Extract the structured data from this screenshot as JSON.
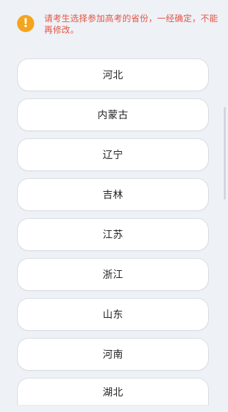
{
  "notice": {
    "icon": "exclamation-icon",
    "text": "请考生选择参加高考的省份，一经确定，不能再修改。"
  },
  "provinces": [
    {
      "label": "河北"
    },
    {
      "label": "内蒙古"
    },
    {
      "label": "辽宁"
    },
    {
      "label": "吉林"
    },
    {
      "label": "江苏"
    },
    {
      "label": "浙江"
    },
    {
      "label": "山东"
    },
    {
      "label": "河南"
    },
    {
      "label": "湖北"
    }
  ],
  "colors": {
    "background": "#eef1f6",
    "notice_text": "#e45444",
    "warning_icon": "#f5a51d",
    "button_bg": "#ffffff",
    "button_border": "#d9dde3",
    "text": "#222222"
  }
}
